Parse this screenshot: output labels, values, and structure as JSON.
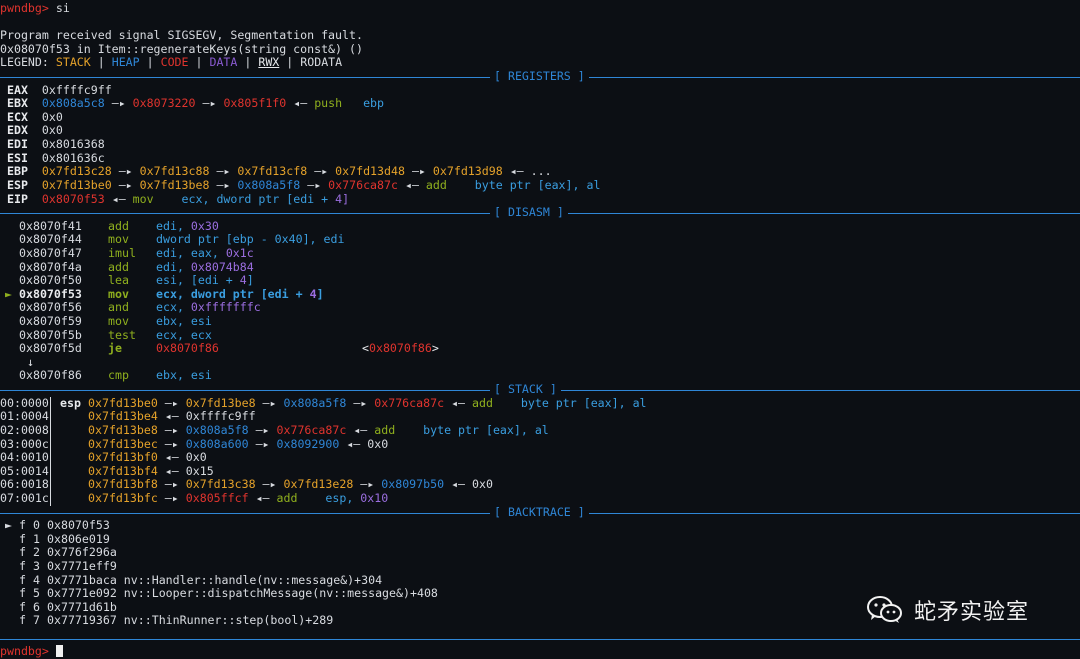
{
  "prompt": "pwndbg>",
  "command": "si",
  "signal_line": "Program received signal SIGSEGV, Segmentation fault.",
  "location_line": "0x08070f53 in Item::regenerateKeys(string const&) ()",
  "legend": {
    "label": "LEGEND:",
    "stack": "STACK",
    "heap": "HEAP",
    "code": "CODE",
    "data": "DATA",
    "rwx": "RWX",
    "rodata": "RODATA",
    "sep": "|"
  },
  "sections": {
    "registers": "[ REGISTERS ]",
    "disasm": "[ DISASM ]",
    "stack": "[ STACK ]",
    "backtrace": "[ BACKTRACE ]"
  },
  "arrow": "—▸",
  "arrow_back": "◂—",
  "registers": {
    "eax": {
      "name": "EAX",
      "v0": "0xffffc9ff"
    },
    "ebx": {
      "name": "EBX",
      "v0": "0x808a5c8",
      "v1": "0x8073220",
      "v2": "0x805f1f0",
      "ins": "push",
      "arg": "ebp"
    },
    "ecx": {
      "name": "ECX",
      "v0": "0x0"
    },
    "edx": {
      "name": "EDX",
      "v0": "0x0"
    },
    "edi": {
      "name": "EDI",
      "v0": "0x8016368"
    },
    "esi": {
      "name": "ESI",
      "v0": "0x801636c"
    },
    "ebp": {
      "name": "EBP",
      "v0": "0x7fd13c28",
      "v1": "0x7fd13c88",
      "v2": "0x7fd13cf8",
      "v3": "0x7fd13d48",
      "v4": "0x7fd13d98",
      "tail": "..."
    },
    "esp": {
      "name": "ESP",
      "v0": "0x7fd13be0",
      "v1": "0x7fd13be8",
      "v2": "0x808a5f8",
      "v3": "0x776ca87c",
      "ins": "add",
      "arg": "byte ptr [eax], al"
    },
    "eip": {
      "name": "EIP",
      "v0": "0x8070f53",
      "ins": "mov",
      "arg1": "ecx, dword ptr [edi +",
      "arg2": "4]"
    }
  },
  "disasm": {
    "rows": [
      {
        "addr": "0x8070f41",
        "ins": "add",
        "ops": "edi,",
        "num": "0x30"
      },
      {
        "addr": "0x8070f44",
        "ins": "mov",
        "ops": "dword ptr [ebp - 0x40], edi"
      },
      {
        "addr": "0x8070f47",
        "ins": "imul",
        "ops": "edi, eax,",
        "num": "0x1c"
      },
      {
        "addr": "0x8070f4a",
        "ins": "add",
        "ops": "edi,",
        "num": "0x8074b84"
      },
      {
        "addr": "0x8070f50",
        "ins": "lea",
        "ops": "esi, [edi +",
        "num": "4",
        "close": "]"
      },
      {
        "addr": "0x8070f53",
        "ins": "mov",
        "ops": "ecx, dword ptr [edi +",
        "num": "4",
        "close": "]",
        "marker": "►"
      },
      {
        "addr": "0x8070f56",
        "ins": "and",
        "ops": "ecx,",
        "num": "0xfffffffc"
      },
      {
        "addr": "0x8070f59",
        "ins": "mov",
        "ops": "ebx, esi"
      },
      {
        "addr": "0x8070f5b",
        "ins": "test",
        "ops": "ecx, ecx"
      },
      {
        "addr": "0x8070f5d",
        "ins": "je",
        "target": "0x8070f86",
        "target2": "<0x8070f86>"
      },
      {
        "addr": "0x8070f86",
        "ins": "cmp",
        "ops": "ebx, esi"
      }
    ],
    "down_arrow": "↓"
  },
  "stack": {
    "rows": [
      {
        "idx": "00:0000",
        "reg": "esp",
        "a": "0x7fd13be0",
        "b": "0x7fd13be8",
        "c": "0x808a5f8",
        "d": "0x776ca87c",
        "ins": "add",
        "arg": "byte ptr [eax], al"
      },
      {
        "idx": "01:0004",
        "a": "0x7fd13be4",
        "v": "0xffffc9ff"
      },
      {
        "idx": "02:0008",
        "a": "0x7fd13be8",
        "c": "0x808a5f8",
        "d": "0x776ca87c",
        "ins": "add",
        "arg": "byte ptr [eax], al"
      },
      {
        "idx": "03:000c",
        "a": "0x7fd13bec",
        "c": "0x808a600",
        "e": "0x8092900",
        "v": "0x0"
      },
      {
        "idx": "04:0010",
        "a": "0x7fd13bf0",
        "v": "0x0"
      },
      {
        "idx": "05:0014",
        "a": "0x7fd13bf4",
        "v": "0x15"
      },
      {
        "idx": "06:0018",
        "a": "0x7fd13bf8",
        "b": "0x7fd13c38",
        "b2": "0x7fd13e28",
        "e": "0x8097b50",
        "v": "0x0"
      },
      {
        "idx": "07:001c",
        "a": "0x7fd13bfc",
        "d": "0x805ffcf",
        "ins": "add",
        "arg1": "esp,",
        "arg2": "0x10"
      }
    ]
  },
  "backtrace": {
    "marker": "►",
    "rows": [
      {
        "f": "f 0",
        "addr": "0x8070f53",
        "sym": ""
      },
      {
        "f": "f 1",
        "addr": "0x806e019",
        "sym": ""
      },
      {
        "f": "f 2",
        "addr": "0x776f296a",
        "sym": ""
      },
      {
        "f": "f 3",
        "addr": "0x7771eff9",
        "sym": ""
      },
      {
        "f": "f 4",
        "addr": "0x7771baca",
        "sym": "nv::Handler::handle(nv::message&)+304"
      },
      {
        "f": "f 5",
        "addr": "0x7771e092",
        "sym": "nv::Looper::dispatchMessage(nv::message&)+408"
      },
      {
        "f": "f 6",
        "addr": "0x7771d61b",
        "sym": ""
      },
      {
        "f": "f 7",
        "addr": "0x77719367",
        "sym": "nv::ThinRunner::step(bool)+289"
      }
    ]
  },
  "watermark": {
    "icon": "wechat-icon",
    "text": "蛇矛实验室"
  },
  "colors": {
    "background": "#0c0f14",
    "stack": "#e5a22a",
    "heap": "#2f86d6",
    "code": "#e0342e",
    "data": "#8a5ad0",
    "kw": "#8faf1e"
  }
}
